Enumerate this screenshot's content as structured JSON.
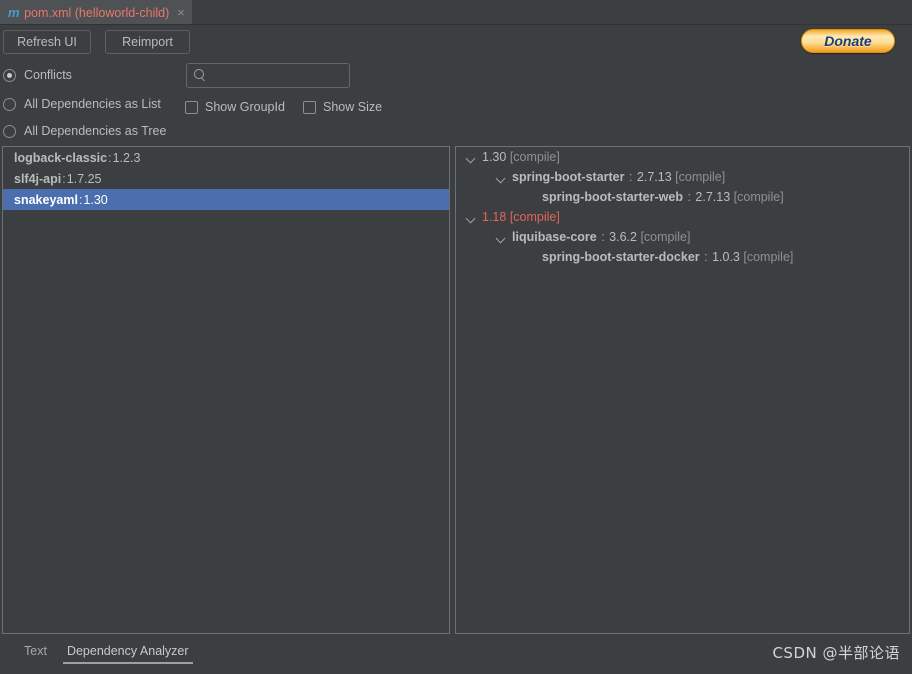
{
  "editor_tab": {
    "icon": "maven-m-icon",
    "title": "pom.xml (helloworld-child)",
    "close": "×"
  },
  "donate": {
    "label": "Donate"
  },
  "toolbar": {
    "refresh_label": "Refresh UI",
    "reimport_label": "Reimport"
  },
  "view_modes": {
    "options": [
      {
        "label": "Conflicts",
        "checked": true
      },
      {
        "label": "All Dependencies as List",
        "checked": false
      },
      {
        "label": "All Dependencies as Tree",
        "checked": false
      }
    ]
  },
  "checkboxes": [
    {
      "label": "Show GroupId",
      "checked": false
    },
    {
      "label": "Show Size",
      "checked": false
    }
  ],
  "search": {
    "value": "",
    "placeholder": ""
  },
  "conflict_list": {
    "rows": [
      {
        "artifact": "logback-classic",
        "sep": ":",
        "version": "1.2.3",
        "selected": false
      },
      {
        "artifact": "slf4j-api",
        "sep": ":",
        "version": "1.7.25",
        "selected": false
      },
      {
        "artifact": "snakeyaml",
        "sep": ":",
        "version": "1.30",
        "selected": true
      }
    ]
  },
  "dependency_tree": {
    "rows": [
      {
        "indent": 0,
        "chevron": true,
        "conflict": false,
        "artifact": "",
        "sep": "",
        "version": "1.30",
        "scope": "[compile]"
      },
      {
        "indent": 1,
        "chevron": true,
        "conflict": false,
        "artifact": "spring-boot-starter",
        "sep": ":",
        "version": "2.7.13",
        "scope": "[compile]"
      },
      {
        "indent": 2,
        "chevron": false,
        "conflict": false,
        "artifact": "spring-boot-starter-web",
        "sep": ":",
        "version": "2.7.13",
        "scope": "[compile]"
      },
      {
        "indent": 0,
        "chevron": true,
        "conflict": true,
        "artifact": "",
        "sep": "",
        "version": "1.18",
        "scope": "[compile]"
      },
      {
        "indent": 1,
        "chevron": true,
        "conflict": false,
        "artifact": "liquibase-core",
        "sep": ":",
        "version": "3.6.2",
        "scope": "[compile]"
      },
      {
        "indent": 2,
        "chevron": false,
        "conflict": false,
        "artifact": "spring-boot-starter-docker",
        "sep": ":",
        "version": "1.0.3",
        "scope": "[compile]"
      }
    ]
  },
  "bottom_tabs": [
    {
      "label": "Text",
      "active": false
    },
    {
      "label": "Dependency Analyzer",
      "active": true
    }
  ],
  "watermark": {
    "text": "CSDN @半部论语"
  },
  "colors": {
    "background": "#3c3f41",
    "selection": "#4b6eaf",
    "conflict_red": "#e8635a",
    "tab_title": "#e8766a",
    "donate_accent": "#f5a623"
  }
}
